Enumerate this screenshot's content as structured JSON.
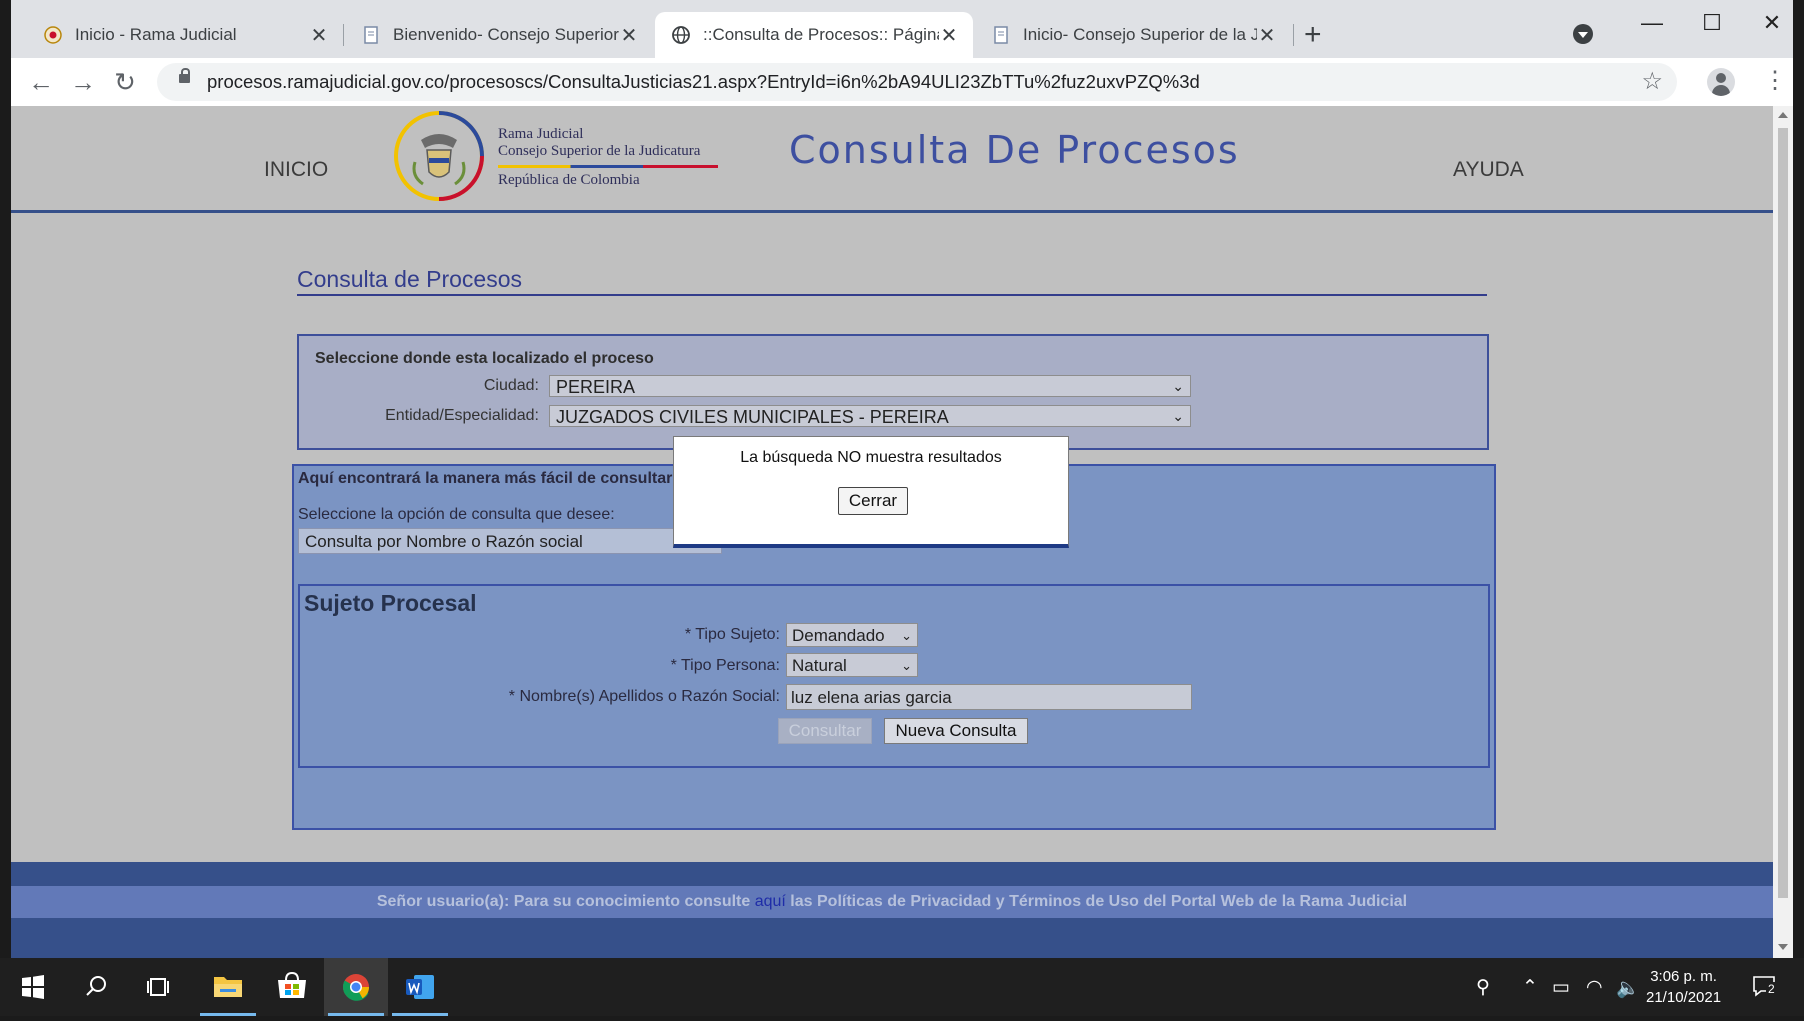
{
  "browser": {
    "tabs": [
      {
        "title": "Inicio - Rama Judicial"
      },
      {
        "title": "Bienvenido- Consejo Superior de la Judicatura"
      },
      {
        "title": "::Consulta de Procesos:: Página Principal"
      },
      {
        "title": "Inicio- Consejo Superior de la Judicatura"
      }
    ],
    "address": "procesos.ramajudicial.gov.co/procesoscs/ConsultaJusticias21.aspx?EntryId=i6n%2bA94ULI23ZbTTu%2fuz2uxvPZQ%3d"
  },
  "site": {
    "nav_left": "INICIO",
    "nav_right": "AYUDA",
    "institution": {
      "line1": "Rama Judicial",
      "line2": "Consejo Superior de la Judicatura",
      "line3": "República de Colombia"
    },
    "title": "Consulta De Procesos"
  },
  "page": {
    "section_title": "Consulta de Procesos",
    "location": {
      "heading": "Seleccione donde esta localizado el proceso",
      "ciudad_label": "Ciudad:",
      "ciudad_value": "PEREIRA",
      "entidad_label": "Entidad/Especialidad:",
      "entidad_value": "JUZGADOS CIVILES MUNICIPALES - PEREIRA"
    },
    "consulta": {
      "heading": "Aquí encontrará la manera más fácil de consultar su proceso.",
      "option_label": "Seleccione la opción de consulta que desee:",
      "option_value": "Consulta por Nombre o Razón social"
    },
    "sujeto": {
      "title": "Sujeto Procesal",
      "tipo_sujeto_label": "* Tipo Sujeto:",
      "tipo_sujeto_value": "Demandado",
      "tipo_persona_label": "* Tipo Persona:",
      "tipo_persona_value": "Natural",
      "nombre_label": "* Nombre(s) Apellidos o Razón Social:",
      "nombre_value": "luz elena arias garcia",
      "consultar_label": "Consultar",
      "nueva_label": "Nueva Consulta"
    },
    "dialog": {
      "message": "La búsqueda NO muestra resultados",
      "close_label": "Cerrar"
    },
    "footer": {
      "before": "Señor usuario(a): Para su conocimiento consulte ",
      "link": "aquí",
      "after": " las Políticas de Privacidad y Términos de Uso del Portal Web de la Rama Judicial"
    }
  },
  "taskbar": {
    "time": "3:06 p. m.",
    "date": "21/10/2021",
    "notification_count": "2"
  }
}
